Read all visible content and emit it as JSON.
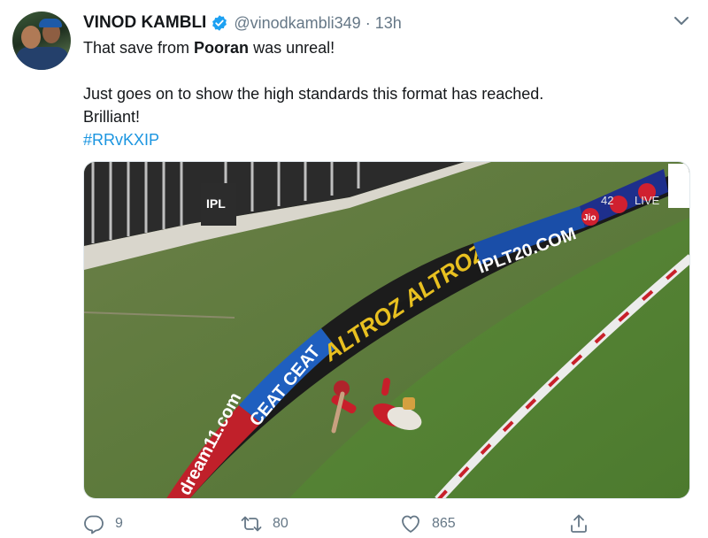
{
  "tweet": {
    "author_name": "VINOD KAMBLI",
    "handle": "@vinodkambli349",
    "separator": "·",
    "time": "13h",
    "verified": true,
    "line1_pre": "That save from ",
    "line1_bold": "Pooran",
    "line1_post": " was unreal!",
    "line2": "Just goes on to show the high standards this format has reached.",
    "line3": "Brilliant!",
    "hashtag": "#RRvKXIP"
  },
  "media": {
    "type": "video-still",
    "boards": {
      "ipl_logo": "IPL",
      "altroz": "ALTROZ ALTROZ",
      "ipl_site": "IPLT20.COM",
      "ceat": "CEAT CEAT",
      "dream11": "dream11.com",
      "jio": "Jio",
      "viewer_count": "42",
      "live_label": "LIVE"
    }
  },
  "actions": {
    "reply_count": "9",
    "retweet_count": "80",
    "like_count": "865"
  },
  "colors": {
    "link": "#1b95e0",
    "verified": "#1da1f2",
    "muted": "#657786",
    "grass": "#5e7a3e"
  },
  "icons": [
    "verified-badge-icon",
    "chevron-down-icon",
    "reply-icon",
    "retweet-icon",
    "like-icon",
    "share-icon"
  ]
}
